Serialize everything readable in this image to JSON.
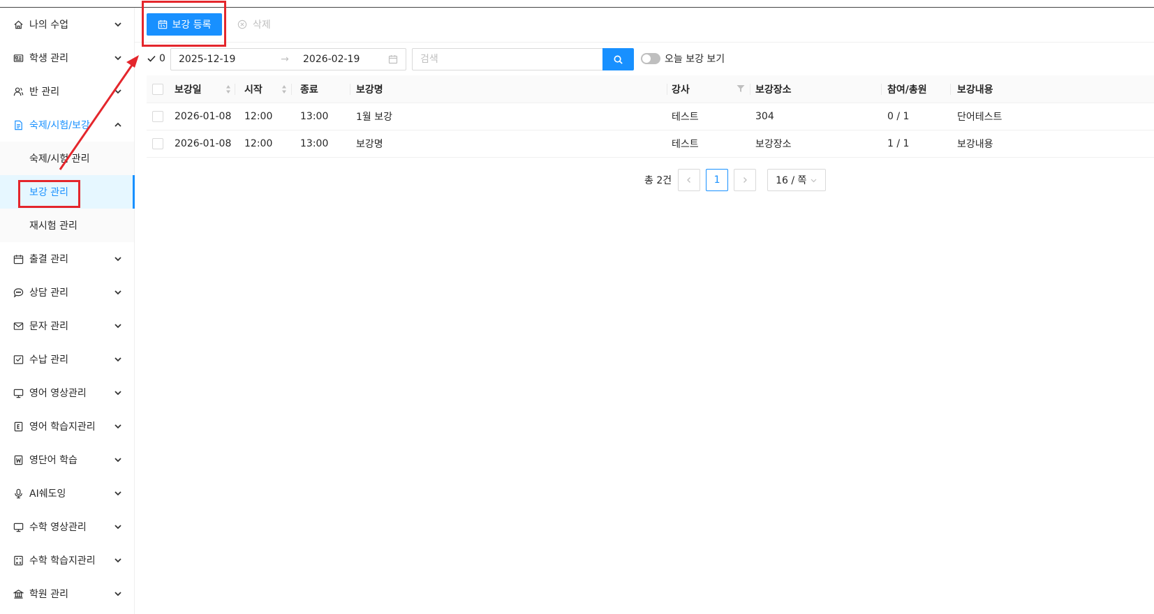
{
  "sidebar": {
    "items": [
      {
        "label": "나의 수업",
        "icon": "home-icon"
      },
      {
        "label": "학생 관리",
        "icon": "id-card-icon"
      },
      {
        "label": "반 관리",
        "icon": "users-icon"
      },
      {
        "label": "숙제/시험/보강",
        "icon": "document-icon"
      },
      {
        "label": "출결 관리",
        "icon": "calendar-icon"
      },
      {
        "label": "상담 관리",
        "icon": "chat-icon"
      },
      {
        "label": "문자 관리",
        "icon": "mail-icon"
      },
      {
        "label": "수납 관리",
        "icon": "receipt-icon"
      },
      {
        "label": "영어 영상관리",
        "icon": "monitor-icon"
      },
      {
        "label": "영어 학습지관리",
        "icon": "e-book-icon"
      },
      {
        "label": "영단어 학습",
        "icon": "word-icon"
      },
      {
        "label": "AI쉐도잉",
        "icon": "microphone-icon"
      },
      {
        "label": "수학 영상관리",
        "icon": "monitor-icon"
      },
      {
        "label": "수학 학습지관리",
        "icon": "calculator-icon"
      },
      {
        "label": "학원 관리",
        "icon": "bank-icon"
      }
    ],
    "submenu": [
      {
        "label": "숙제/시험 관리"
      },
      {
        "label": "보강 관리"
      },
      {
        "label": "재시험 관리"
      }
    ]
  },
  "toolbar": {
    "register_label": "보강 등록",
    "delete_label": "삭제"
  },
  "filters": {
    "selected_count": "0",
    "date_start": "2025-12-19",
    "date_end": "2026-02-19",
    "date_separator": "→",
    "search_placeholder": "검색",
    "today_toggle_label": "오늘 보강 보기"
  },
  "table": {
    "headers": {
      "date": "보강일",
      "start": "시작",
      "end": "종료",
      "name": "보강명",
      "teacher": "강사",
      "place": "보강장소",
      "attendance": "참여/총원",
      "content": "보강내용"
    },
    "rows": [
      {
        "date": "2026-01-08",
        "start": "12:00",
        "end": "13:00",
        "name": "1월 보강",
        "teacher": "테스트",
        "place": "304",
        "attendance": "0 / 1",
        "content": "단어테스트"
      },
      {
        "date": "2026-01-08",
        "start": "12:00",
        "end": "13:00",
        "name": "보강명",
        "teacher": "테스트",
        "place": "보강장소",
        "attendance": "1 / 1",
        "content": "보강내용"
      }
    ]
  },
  "pagination": {
    "total": "총 2건",
    "current_page": "1",
    "page_size": "16 / 쪽"
  },
  "colors": {
    "primary": "#1890ff",
    "annotation": "#e4262c"
  }
}
